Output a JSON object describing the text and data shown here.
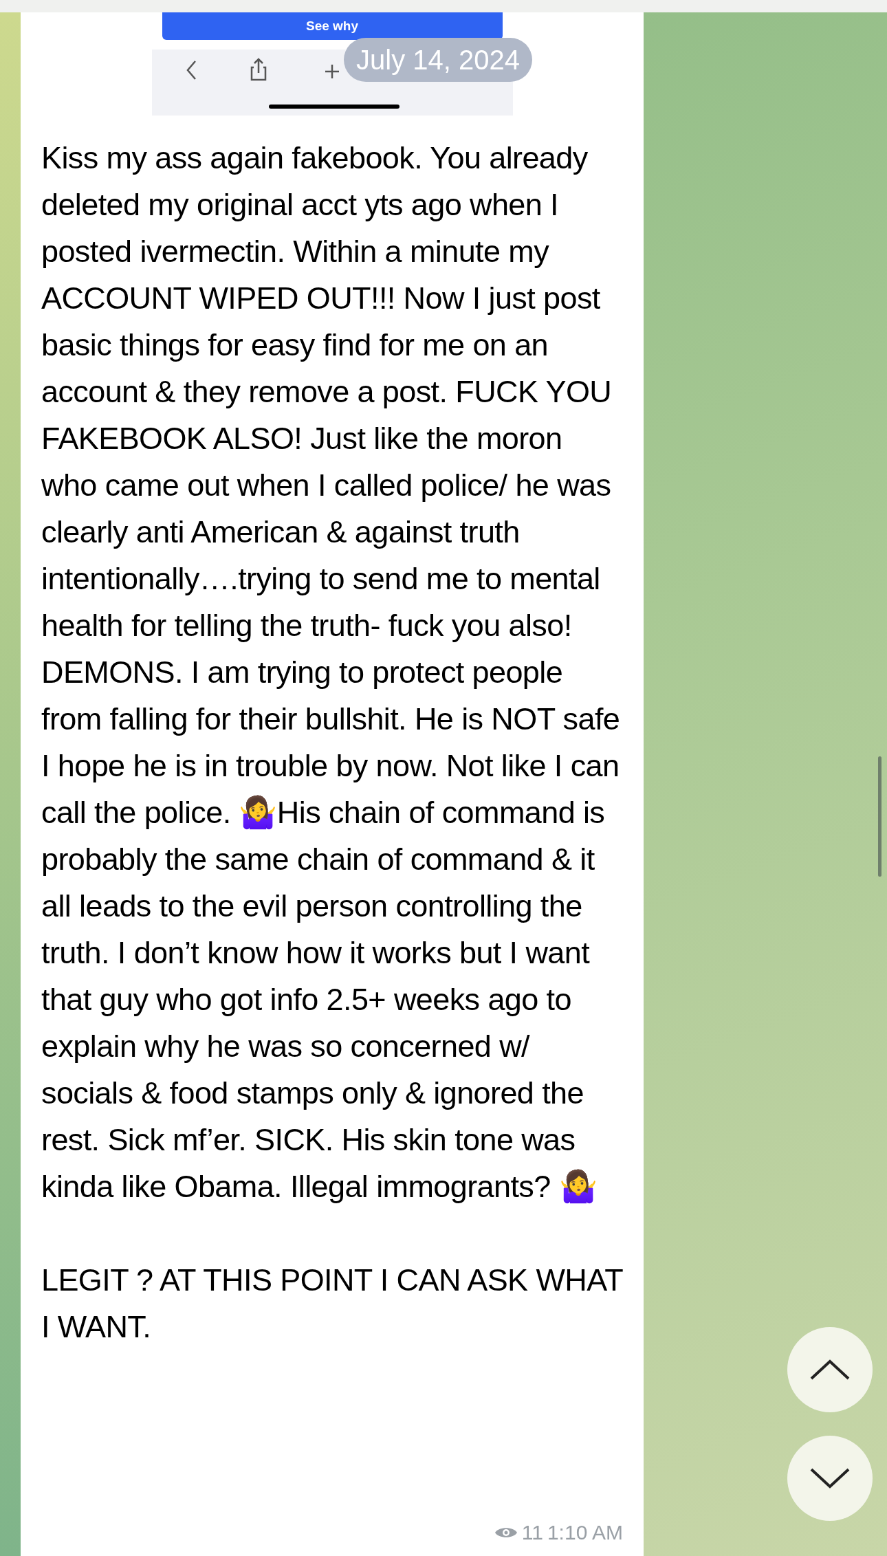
{
  "embedded_screenshot": {
    "button": "See why"
  },
  "date_badge": "July 14, 2024",
  "message": {
    "paragraphs": [
      "Kiss my ass again fakebook. You already deleted my original acct yts ago when I posted ivermectin. Within a minute my ACCOUNT WIPED OUT!!! Now I just post basic things for easy find for me on an account & they remove a post. FUCK YOU FAKEBOOK ALSO! Just like the moron who came out when I called police/ he was clearly anti American & against truth intentionally….trying to send me to mental health for telling the truth- fuck you also! DEMONS. I am trying to protect people from falling for their bullshit. He is NOT safe I hope he is in trouble by now. Not like I can call the police. 🤷‍♀️His chain of command is probably the same chain of command & it all leads to the evil person controlling the truth. I don’t know how it works but I want that guy who got info 2.5+ weeks ago to explain why he was so concerned w/ socials & food stamps only & ignored the rest. Sick mf’er. SICK. His skin tone was kinda like Obama. Illegal immogrants? 🤷‍♀️",
      "LEGIT ? AT THIS POINT I CAN ASK WHAT I WANT."
    ],
    "views": "11",
    "time": "1:10 AM"
  }
}
